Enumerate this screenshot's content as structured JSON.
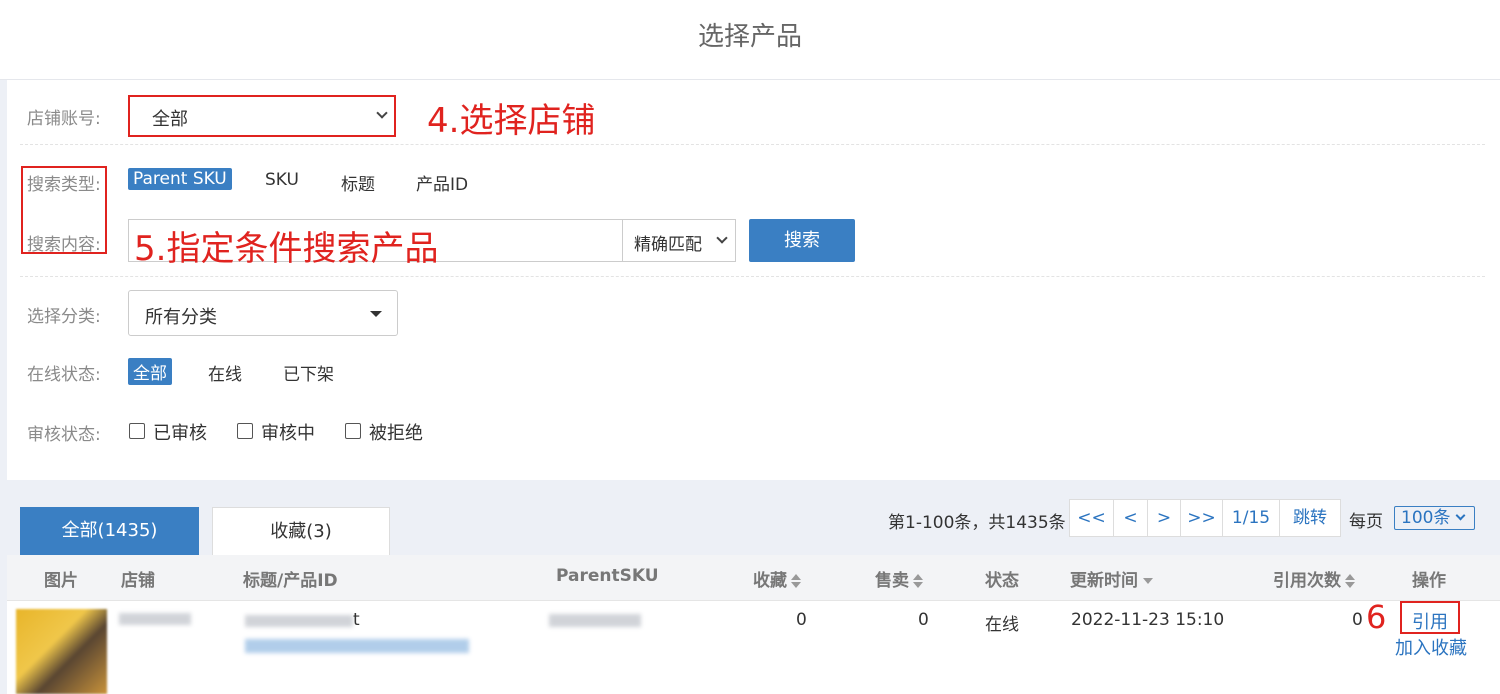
{
  "header": {
    "title": "选择产品"
  },
  "filters": {
    "store_label": "店铺账号:",
    "store_value": "全部",
    "search_type_label": "搜索类型:",
    "search_types": [
      "Parent SKU",
      "SKU",
      "标题",
      "产品ID"
    ],
    "search_type_active": "Parent SKU",
    "search_content_label": "搜索内容:",
    "search_value": "",
    "match_mode": "精确匹配",
    "search_button": "搜索",
    "category_label": "选择分类:",
    "category_value": "所有分类",
    "online_status_label": "在线状态:",
    "online_status_options": [
      "全部",
      "在线",
      "已下架"
    ],
    "review_status_label": "审核状态:",
    "review_options": [
      "已审核",
      "审核中",
      "被拒绝"
    ]
  },
  "annotations": {
    "step4": "4.选择店铺",
    "step5": "5.指定条件搜索产品",
    "step6": "6"
  },
  "tabs": {
    "all": "全部(1435)",
    "favorites": "收藏(3)"
  },
  "pagination": {
    "summary": "第1-100条，共1435条",
    "first": "<<",
    "prev": "<",
    "next": ">",
    "last": ">>",
    "page": "1/15",
    "jump": "跳转",
    "per_page_label": "每页",
    "per_page_value": "100条"
  },
  "table": {
    "columns": [
      "图片",
      "店铺",
      "标题/产品ID",
      "ParentSKU",
      "收藏",
      "售卖",
      "状态",
      "更新时间",
      "引用次数",
      "操作"
    ],
    "rows": [
      {
        "title_suffix": "t",
        "favorites": "0",
        "sold": "0",
        "status": "在线",
        "updated": "2022-11-23 15:10",
        "ref_count": "0",
        "action_use": "引用",
        "action_fav": "加入收藏"
      }
    ]
  },
  "colors": {
    "accent": "#3a7fc3",
    "annotation": "#e0231f",
    "link": "#2b74c0"
  }
}
